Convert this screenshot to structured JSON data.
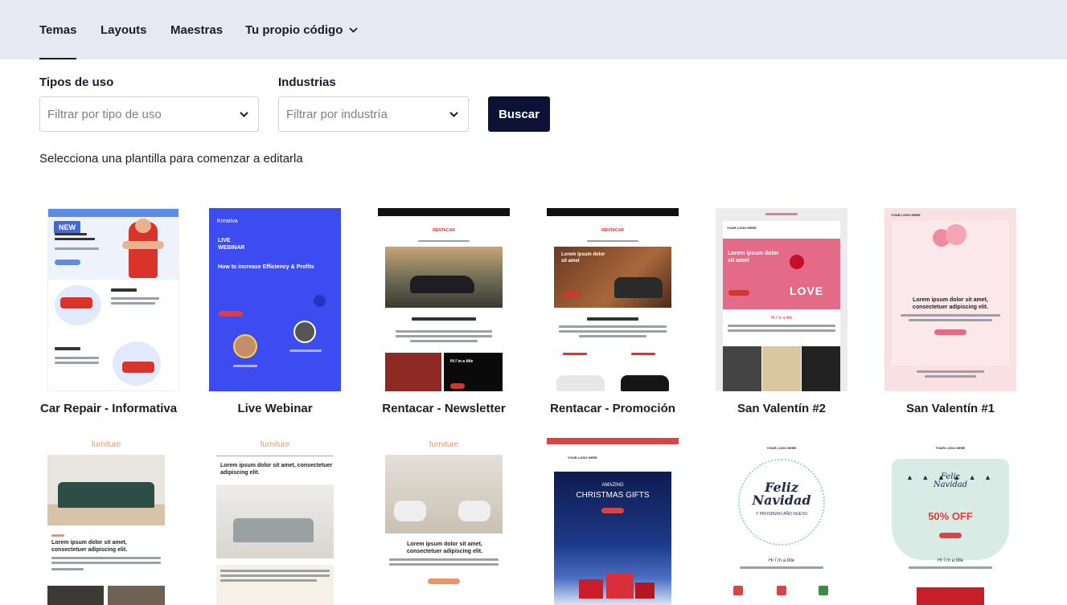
{
  "tabs": [
    {
      "label": "Temas",
      "active": true
    },
    {
      "label": "Layouts",
      "active": false
    },
    {
      "label": "Maestras",
      "active": false
    },
    {
      "label": "Tu propio código",
      "active": false,
      "dropdown": true
    }
  ],
  "filters": {
    "usage": {
      "label": "Tipos de uso",
      "placeholder": "Filtrar por tipo de uso"
    },
    "industry": {
      "label": "Industrias",
      "placeholder": "Filtrar por industría"
    },
    "search_label": "Buscar"
  },
  "hint": "Selecciona una plantilla para comenzar a editarla",
  "templates_row1": [
    {
      "name": "Car Repair - Informativa",
      "badge": "NEW"
    },
    {
      "name": "Live Webinar"
    },
    {
      "name": "Rentacar - Newsletter"
    },
    {
      "name": "Rentacar - Promoción"
    },
    {
      "name": "San Valentín #2"
    },
    {
      "name": "San Valentín #1"
    }
  ],
  "thumb_text": {
    "furniture": "furniture",
    "lorem_title": "Lorem ipsum dolor sit amet, consectetuer adipiscing elit.",
    "christmas_amazing": "AMAZING",
    "christmas_gifts": "CHRISTMAS GIFTS",
    "feliz": "Feliz",
    "navidad": "Navidad",
    "prospero": "Y PROSPERO AÑO NUEVO",
    "off": "50% OFF",
    "logo": "YOUR LOGO HERE",
    "hi_title": "Hi I´m a title",
    "webinar_brand": "Kreativa",
    "webinar_live": "LIVE WEBINAR",
    "webinar_headline": "How to increase Efficiency & Profits",
    "rentacar": "RENTACAR",
    "love": "LOVE",
    "car_heading": "Lorem ipsum dolor sit amet"
  },
  "colors": {
    "topbar": "#e6e9f2",
    "primary_button": "#0b1233",
    "webinar_blue": "#3d4cf0",
    "furniture_orange": "#e8956b",
    "valentine_pink": "#f6c9cf"
  }
}
